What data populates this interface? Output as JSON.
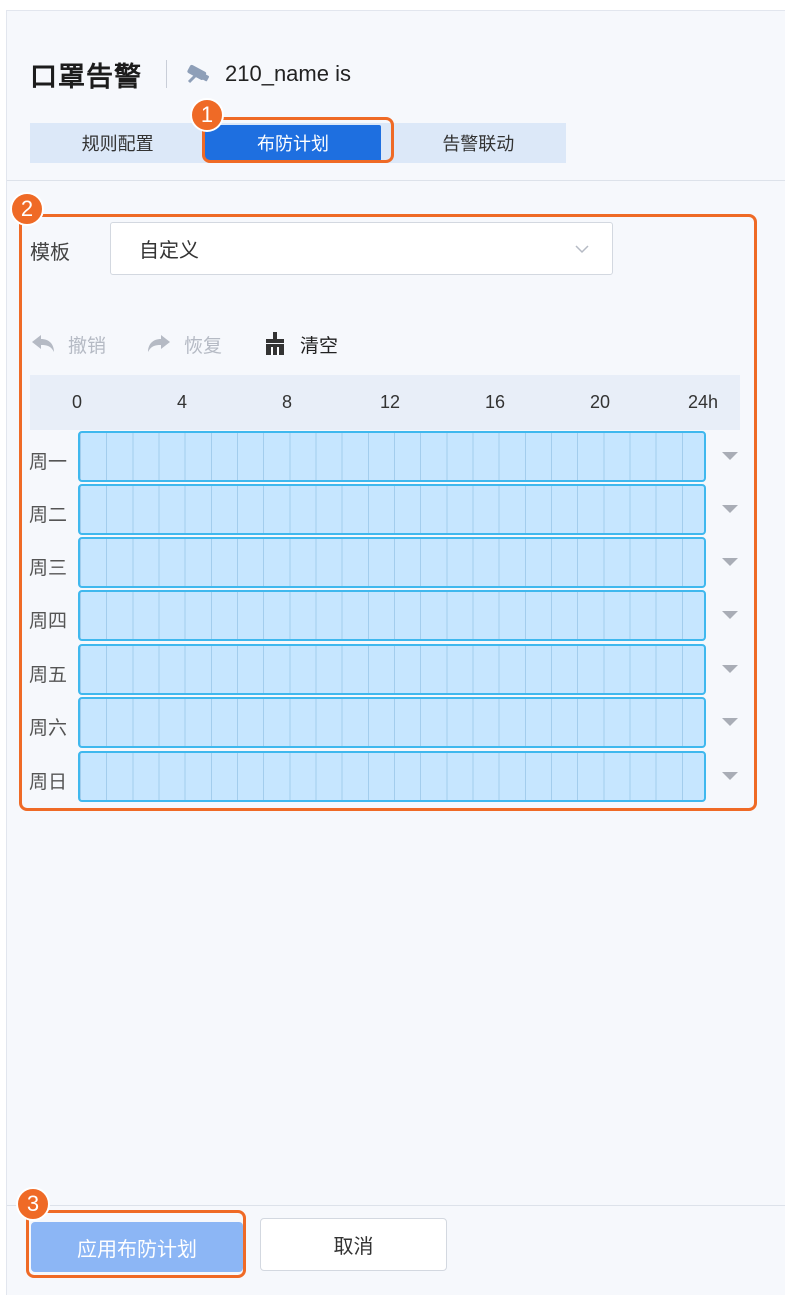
{
  "header": {
    "title": "口罩告警",
    "device_name": "210_name is"
  },
  "tabs": [
    {
      "label": "规则配置",
      "active": false
    },
    {
      "label": "布防计划",
      "active": true
    },
    {
      "label": "告警联动",
      "active": false
    }
  ],
  "annotations": {
    "step1": "1",
    "step2": "2",
    "step3": "3",
    "color": "#ef6a26"
  },
  "template": {
    "label": "模板",
    "value": "自定义"
  },
  "toolbar": {
    "undo": "撤销",
    "redo": "恢复",
    "clear": "清空"
  },
  "hours": [
    "0",
    "4",
    "8",
    "12",
    "16",
    "20",
    "24h"
  ],
  "schedule": [
    {
      "day": "周一",
      "armed_fraction": 1.0
    },
    {
      "day": "周二",
      "armed_fraction": 1.0
    },
    {
      "day": "周三",
      "armed_fraction": 1.0
    },
    {
      "day": "周四",
      "armed_fraction": 1.0
    },
    {
      "day": "周五",
      "armed_fraction": 1.0
    },
    {
      "day": "周六",
      "armed_fraction": 1.0
    },
    {
      "day": "周日",
      "armed_fraction": 1.0
    }
  ],
  "footer": {
    "apply_label": "应用布防计划",
    "cancel_label": "取消"
  },
  "colors": {
    "accent": "#1e6fe0",
    "schedule_fill": "#c6e6ff",
    "schedule_border": "#3fb8ee"
  }
}
